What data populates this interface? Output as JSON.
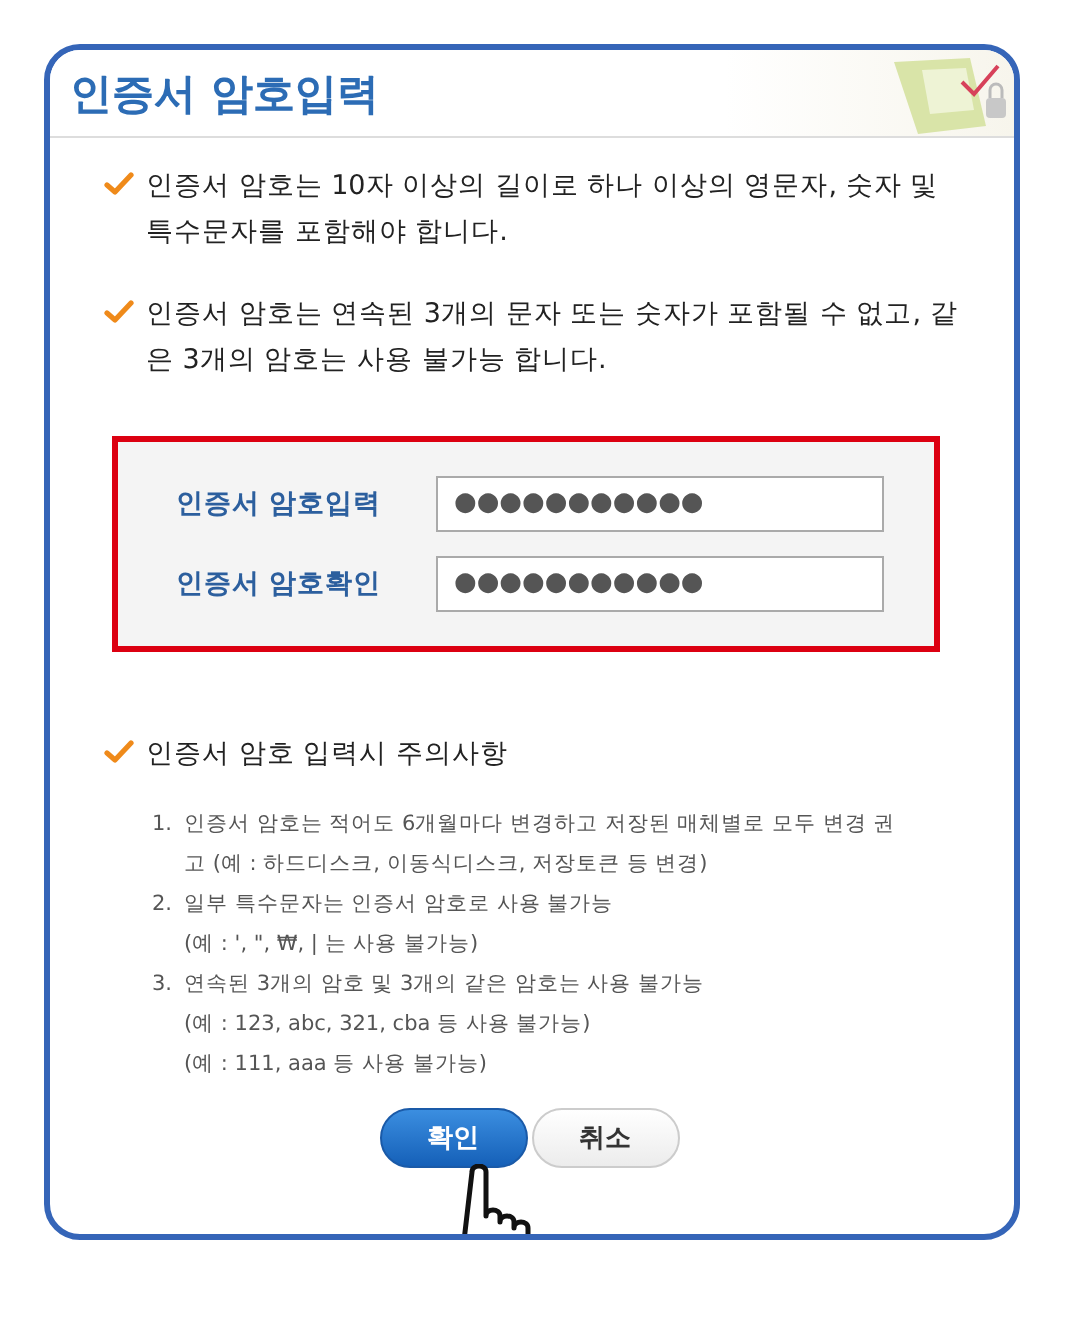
{
  "dialog": {
    "title": "인증서 암호입력",
    "rules": [
      "인증서 암호는 10자 이상의 길이로 하나 이상의 영문자, 숫자 및 특수문자를 포함해야 합니다.",
      "인증서 암호는 연속된 3개의 문자 또는 숫자가 포함될 수 없고, 같은 3개의 암호는 사용 불가능 합니다."
    ],
    "fields": [
      {
        "label": "인증서 암호입력",
        "value": "●●●●●●●●●●●"
      },
      {
        "label": "인증서 암호확인",
        "value": "●●●●●●●●●●●"
      }
    ],
    "notice": {
      "heading": "인증서 암호 입력시 주의사항",
      "items": [
        {
          "number": "1.",
          "text": "인증서 암호는 적어도 6개월마다 변경하고 저장된 매체별로 모두 변경 권고 (예 : 하드디스크, 이동식디스크, 저장토큰 등 변경)"
        },
        {
          "number": "2.",
          "text": "일부 특수문자는 인증서 암호로 사용 불가능",
          "examples": [
            "(예 : ', \", ₩, | 는 사용 불가능)"
          ]
        },
        {
          "number": "3.",
          "text": "연속된 3개의 암호 및 3개의 같은 암호는 사용 불가능",
          "examples": [
            "(예 : 123, abc, 321, cba 등 사용 불가능)",
            "(예 : 111, aaa 등 사용 불가능)"
          ]
        }
      ]
    },
    "buttons": [
      {
        "label": "확인",
        "kind": "primary"
      },
      {
        "label": "취소",
        "kind": "secondary"
      }
    ]
  }
}
